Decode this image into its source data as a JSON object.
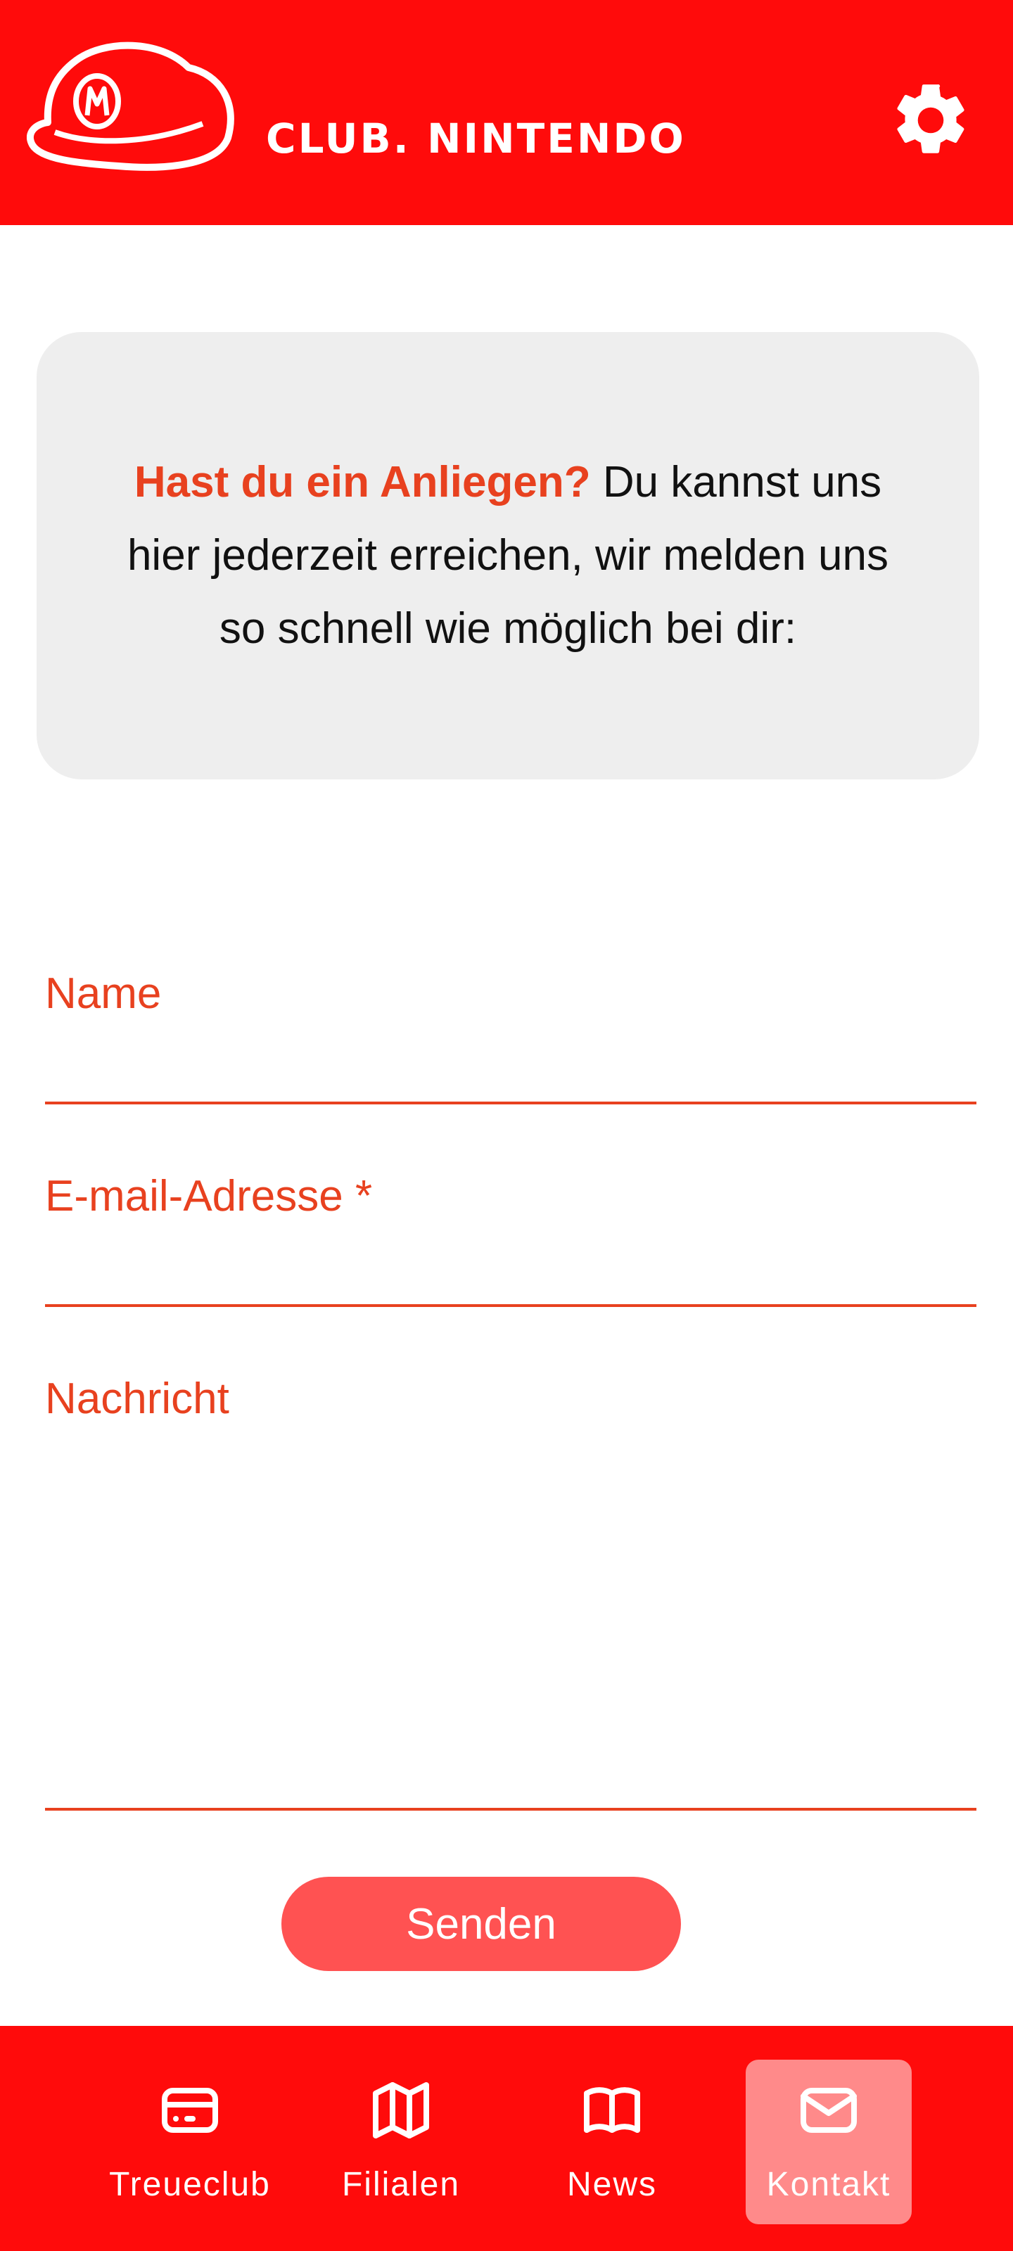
{
  "header": {
    "brand": "CLUB. NINTENDO",
    "logo_icon": "mario-cap-icon",
    "settings_icon": "gear-icon"
  },
  "intro": {
    "highlight": "Hast du ein Anliegen?",
    "text": " Du kannst uns hier jederzeit erreichen, wir melden uns so schnell wie möglich bei dir:"
  },
  "form": {
    "name_label": "Name",
    "name_value": "",
    "email_label": "E-mail-Adresse *",
    "email_value": "",
    "message_label": "Nachricht",
    "message_value": "",
    "submit_label": "Senden"
  },
  "nav": {
    "items": [
      {
        "label": "Treueclub",
        "icon": "card-icon",
        "active": false
      },
      {
        "label": "Filialen",
        "icon": "map-icon",
        "active": false
      },
      {
        "label": "News",
        "icon": "book-icon",
        "active": false
      },
      {
        "label": "Kontakt",
        "icon": "mail-icon",
        "active": true
      }
    ]
  },
  "colors": {
    "brand_red": "#ff0b0b",
    "accent": "#e8411f",
    "button": "#ff5252",
    "active_nav": "#ff8a8a",
    "card_bg": "#eeeeee"
  }
}
